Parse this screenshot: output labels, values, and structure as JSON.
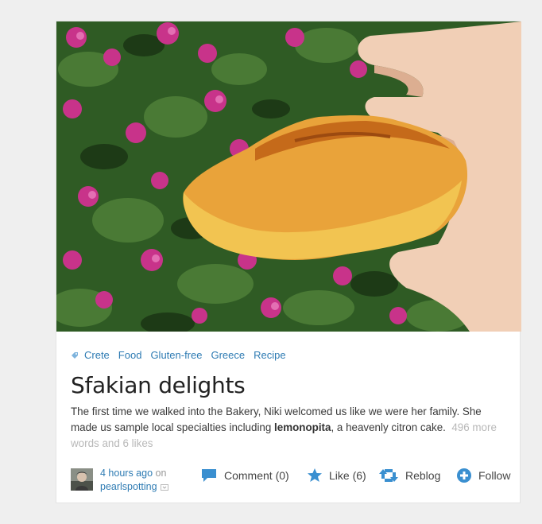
{
  "post": {
    "tags": [
      "Crete",
      "Food",
      "Gluten-free",
      "Greece",
      "Recipe"
    ],
    "title": "Sfakian delights",
    "excerpt_before": "The first time we walked into the Bakery, Niki welcomed us like we were her family. She made us sample local specialties including ",
    "excerpt_bold": "lemonopita",
    "excerpt_after": ", a heavenly citron cake.",
    "more": "496 more words and 6 likes"
  },
  "meta": {
    "time": "4 hours ago",
    "on": "on",
    "user": "pearlspotting"
  },
  "actions": {
    "comment": "Comment (0)",
    "like": "Like (6)",
    "reblog": "Reblog",
    "follow": "Follow"
  },
  "colors": {
    "link": "#2e7bb3",
    "icon": "#3a8fd0",
    "muted": "#b8b8b8"
  },
  "icons": {
    "tag": "tag-icon",
    "comment": "comment-icon",
    "like": "star-icon",
    "reblog": "reblog-icon",
    "follow": "plus-circle-icon",
    "menu": "dropdown-icon"
  }
}
